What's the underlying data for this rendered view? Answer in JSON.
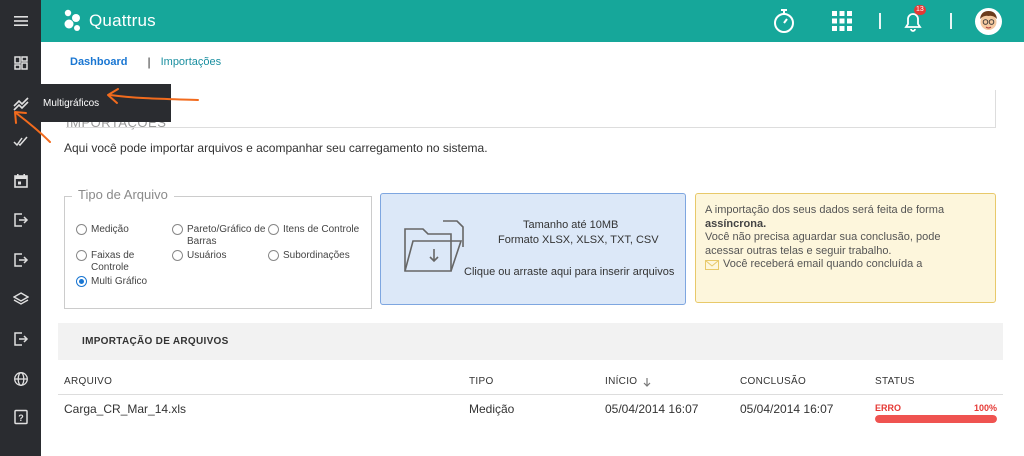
{
  "app": {
    "name": "Quattrus"
  },
  "header": {
    "notification_count": "13"
  },
  "breadcrumb": {
    "current": "Dashboard",
    "separator": "|",
    "link": "Importações"
  },
  "tooltip": {
    "label": "Multigráficos"
  },
  "section": {
    "title": "IMPORTAÇÕES",
    "intro": "Aqui você pode importar arquivos e acompanhar seu carregamento no sistema."
  },
  "file_type": {
    "legend": "Tipo de Arquivo",
    "options": [
      {
        "label_1": "Medição",
        "label_2": "",
        "selected": false
      },
      {
        "label_1": "Pareto/Gráfico de",
        "label_2": "Barras",
        "selected": false
      },
      {
        "label_1": "Itens de Controle",
        "label_2": "",
        "selected": false
      },
      {
        "label_1": "Faixas de",
        "label_2": "Controle",
        "selected": false
      },
      {
        "label_1": "Usuários",
        "label_2": "",
        "selected": false
      },
      {
        "label_1": "Subordinações",
        "label_2": "",
        "selected": false
      },
      {
        "label_1": "Multi Gráfico",
        "label_2": "",
        "selected": true
      }
    ]
  },
  "upload": {
    "size_limit": "Tamanho até 10MB",
    "formats": "Formato XLSX, XLSX, TXT, CSV",
    "instruction": "Clique ou arraste aqui para inserir arquivos"
  },
  "info": {
    "line1": "A importação dos seus dados será feita de forma",
    "line2_bold": "assíncrona.",
    "line3": "Você não precisa aguardar sua conclusão, pode",
    "line4": "acessar outras telas e seguir trabalho.",
    "line5": "Você receberá email quando concluída a"
  },
  "table": {
    "title": "IMPORTAÇÃO DE ARQUIVOS",
    "columns": {
      "file": "ARQUIVO",
      "type": "TIPO",
      "start": "INÍCIO",
      "end": "CONCLUSÃO",
      "status": "STATUS"
    },
    "rows": [
      {
        "file": "Carga_CR_Mar_14.xls",
        "type": "Medição",
        "start": "05/04/2014 16:07",
        "end": "05/04/2014 16:07",
        "status": "ERRO",
        "progress_label": "100%",
        "progress": 1.0
      }
    ]
  },
  "colors": {
    "topbar": "#16a79a",
    "sidebar": "#2a2c30",
    "accent_blue": "#1976d2",
    "error_red": "#e53935",
    "annotation_orange": "#f26b1d"
  },
  "icons": {
    "sidebar": [
      "menu-icon",
      "dashboard-icon",
      "multigraph-icon",
      "double-check-icon",
      "calendar-icon",
      "import-icon",
      "export-icon",
      "layers-icon",
      "logout-icon",
      "globe-icon",
      "help-icon"
    ],
    "header": [
      "stopwatch-icon",
      "apps-grid-icon",
      "bell-icon",
      "avatar"
    ]
  }
}
